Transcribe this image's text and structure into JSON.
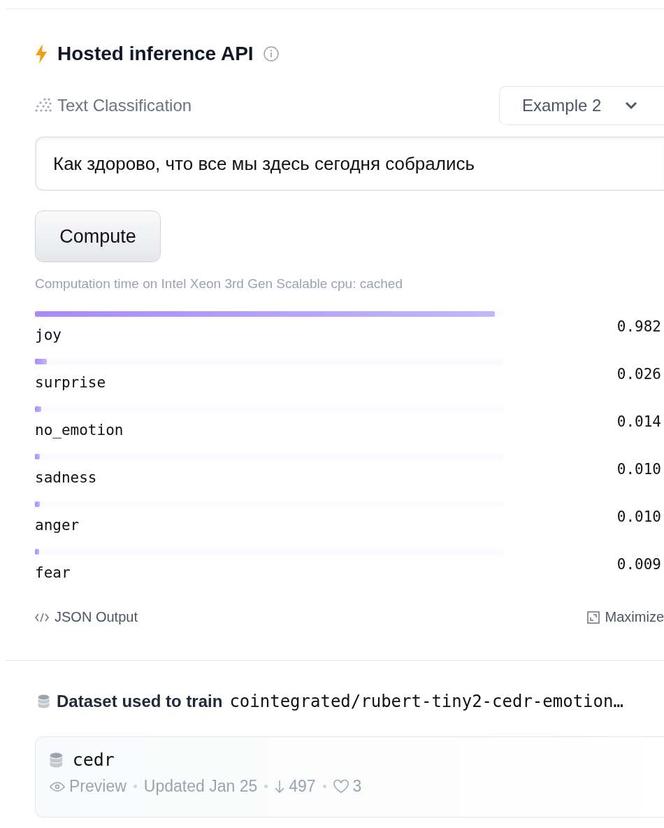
{
  "widget": {
    "title": "Hosted inference API",
    "task": "Text Classification",
    "example_select": "Example 2",
    "input_text": "Как здорово, что все мы здесь сегодня собрались",
    "compute_button": "Compute",
    "computation_note": "Computation time on Intel Xeon 3rd Gen Scalable cpu: cached",
    "results": [
      {
        "label": "joy",
        "score": "0.982",
        "level": 0.982
      },
      {
        "label": "surprise",
        "score": "0.026",
        "level": 0.026
      },
      {
        "label": "no_emotion",
        "score": "0.014",
        "level": 0.014
      },
      {
        "label": "sadness",
        "score": "0.010",
        "level": 0.01
      },
      {
        "label": "anger",
        "score": "0.010",
        "level": 0.01
      },
      {
        "label": "fear",
        "score": "0.009",
        "level": 0.009
      }
    ],
    "json_output": "JSON Output",
    "maximize": "Maximize"
  },
  "datasets": {
    "heading": "Dataset used to train",
    "model": "cointegrated/rubert-tiny2-cedr-emotion…",
    "items": [
      {
        "name": "cedr",
        "preview": "Preview",
        "updated": "Updated Jan 25",
        "downloads": "497",
        "likes": "3"
      }
    ]
  }
}
